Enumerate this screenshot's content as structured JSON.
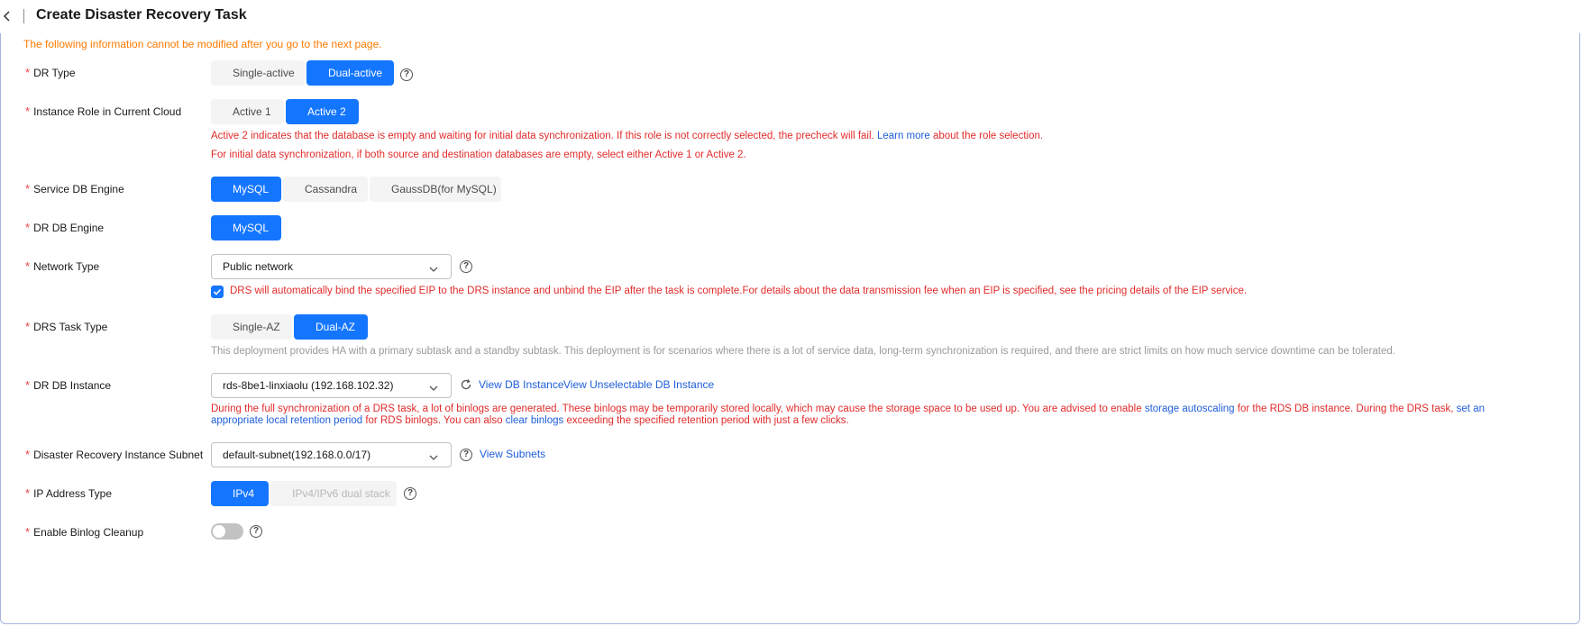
{
  "header": {
    "title": "Create Disaster Recovery Task"
  },
  "notice": "The following information cannot be modified after you go to the next page.",
  "required_mark": "*",
  "help_glyph": "?",
  "dr_type": {
    "label": "DR Type",
    "options": [
      "Single-active",
      "Dual-active"
    ],
    "selected": "Dual-active"
  },
  "instance_role": {
    "label": "Instance Role in Current Cloud",
    "options": [
      "Active 1",
      "Active 2"
    ],
    "selected": "Active 2",
    "warning_line1_prefix": "Active 2 indicates that the database is empty and waiting for initial data synchronization. If this role is not correctly selected, the precheck will fail.",
    "warning_line1_link": "Learn more",
    "warning_line1_suffix": "about the role selection.",
    "warning_line2": "For initial data synchronization, if both source and destination databases are empty, select either Active 1 or Active 2."
  },
  "service_db_engine": {
    "label": "Service DB Engine",
    "options": [
      "MySQL",
      "Cassandra",
      "GaussDB(for MySQL)"
    ],
    "selected": "MySQL"
  },
  "dr_db_engine": {
    "label": "DR DB Engine",
    "options": [
      "MySQL"
    ],
    "selected": "MySQL"
  },
  "network_type": {
    "label": "Network Type",
    "value": "Public network",
    "eip_checkbox_checked": true,
    "eip_note": "DRS will automatically bind the specified EIP to the DRS instance and unbind the EIP after the task is complete.For details about the data transmission fee when an EIP is specified, see the pricing details of the EIP service."
  },
  "drs_task_type": {
    "label": "DRS Task Type",
    "options": [
      "Single-AZ",
      "Dual-AZ"
    ],
    "selected": "Dual-AZ",
    "description": "This deployment provides HA with a primary subtask and a standby subtask. This deployment is for scenarios where there is a lot of service data, long-term synchronization is required, and there are strict limits on how much service downtime can be tolerated."
  },
  "dr_db_instance": {
    "label": "DR DB Instance",
    "value": "rds-8be1-linxiaolu (192.168.102.32)",
    "view_link": "View DB Instance",
    "view_unselectable_link": "View Unselectable DB Instance",
    "warn_a": "During the full synchronization of a DRS task, a lot of binlogs are generated. These binlogs may be temporarily stored locally, which may cause the storage space to be used up. You are advised to enable",
    "warn_link1": "storage autoscaling",
    "warn_b": "for the RDS DB instance. During the DRS task,",
    "warn_link2a": "set an",
    "warn_link2b": "appropriate local retention period",
    "warn_c": "for RDS binlogs. You can also",
    "warn_link3": "clear binlogs",
    "warn_d": "exceeding the specified retention period with just a few clicks."
  },
  "subnet": {
    "label": "Disaster Recovery Instance Subnet",
    "value": "default-subnet(192.168.0.0/17)",
    "view_link": "View Subnets"
  },
  "ip_address_type": {
    "label": "IP Address Type",
    "options": [
      "IPv4",
      "IPv4/IPv6 dual stack"
    ],
    "selected": "IPv4"
  },
  "binlog_cleanup": {
    "label": "Enable Binlog Cleanup",
    "enabled": false
  },
  "colors": {
    "accent": "#1476ff",
    "warning_red": "#e22b2b",
    "notice_orange": "#ff7a00",
    "link_blue": "#1e5eda"
  }
}
